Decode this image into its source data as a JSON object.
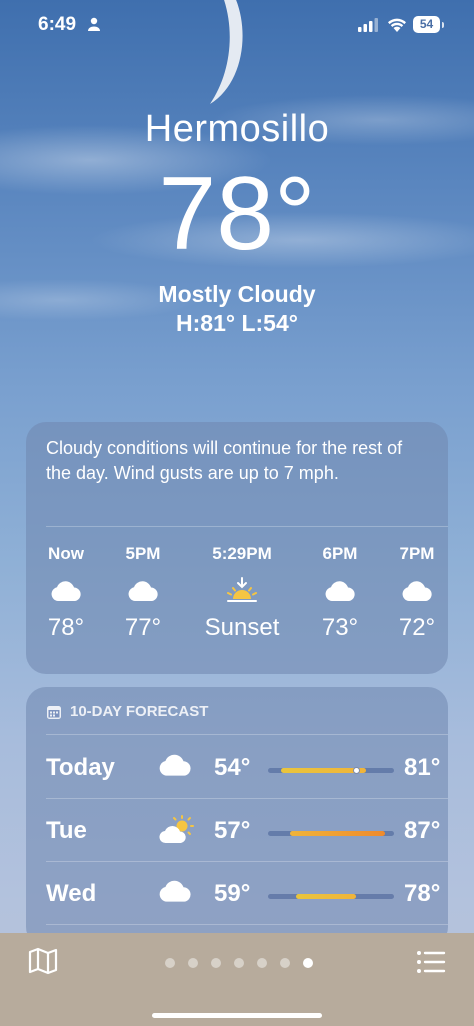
{
  "status_bar": {
    "time": "6:49",
    "battery": "54"
  },
  "header": {
    "city": "Hermosillo",
    "temperature": "78°",
    "condition": "Mostly Cloudy",
    "high_low": "H:81°  L:54°"
  },
  "hourly": {
    "summary": "Cloudy conditions will continue for the rest of the day. Wind gusts are up to 7 mph.",
    "items": [
      {
        "label": "Now",
        "icon": "cloud-icon",
        "temp": "78°"
      },
      {
        "label": "5PM",
        "icon": "cloud-icon",
        "temp": "77°"
      },
      {
        "label": "5:29PM",
        "icon": "sunset-icon",
        "temp": "Sunset"
      },
      {
        "label": "6PM",
        "icon": "cloud-icon",
        "temp": "73°"
      },
      {
        "label": "7PM",
        "icon": "cloud-icon",
        "temp": "72°"
      }
    ]
  },
  "forecast": {
    "title": "10-DAY FORECAST",
    "days": [
      {
        "day": "Today",
        "icon": "cloud-icon",
        "low": "54°",
        "high": "81°",
        "range": [
          54,
          81
        ],
        "current": 78
      },
      {
        "day": "Tue",
        "icon": "partly-sunny-icon",
        "low": "57°",
        "high": "87°",
        "range": [
          57,
          87
        ]
      },
      {
        "day": "Wed",
        "icon": "cloud-icon",
        "low": "59°",
        "high": "78°",
        "range": [
          59,
          78
        ]
      }
    ],
    "scale": [
      50,
      90
    ]
  },
  "pager": {
    "count": 7,
    "active_index": 6
  },
  "colors": {
    "bar_warm": "#f0b43a",
    "bar_hot": "#ef8a2c",
    "bar_yellow": "#e9c53d"
  }
}
